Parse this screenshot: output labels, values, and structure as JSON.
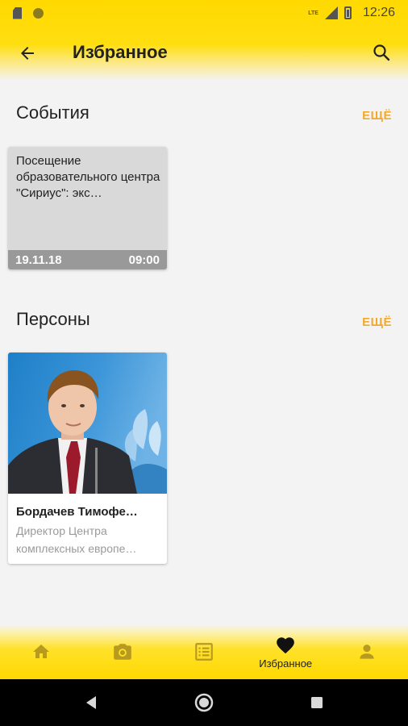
{
  "status_bar": {
    "time": "12:26",
    "network": "LTE"
  },
  "app_bar": {
    "title": "Избранное",
    "back_icon": "arrow-left-icon",
    "search_icon": "search-icon"
  },
  "events": {
    "title": "События",
    "more_label": "ЕЩЁ",
    "items": [
      {
        "title": "Посещение образовательного центра \"Сириус\": экс…",
        "date": "19.11.18",
        "time": "09:00"
      }
    ]
  },
  "persons": {
    "title": "Персоны",
    "more_label": "ЕЩЁ",
    "items": [
      {
        "name": "Бордачев Тимофе…",
        "role": "Директор Центра комплексных европе…"
      }
    ]
  },
  "bottom_nav": {
    "items": [
      {
        "icon": "home-icon",
        "label": "",
        "active": false
      },
      {
        "icon": "camera-icon",
        "label": "",
        "active": false
      },
      {
        "icon": "list-icon",
        "label": "",
        "active": false
      },
      {
        "icon": "heart-icon",
        "label": "Избранное",
        "active": true
      },
      {
        "icon": "person-icon",
        "label": "",
        "active": false
      }
    ]
  },
  "colors": {
    "accent_yellow": "#ffd900",
    "more_link": "#f2a92e",
    "inactive_icon": "#b89a20"
  }
}
